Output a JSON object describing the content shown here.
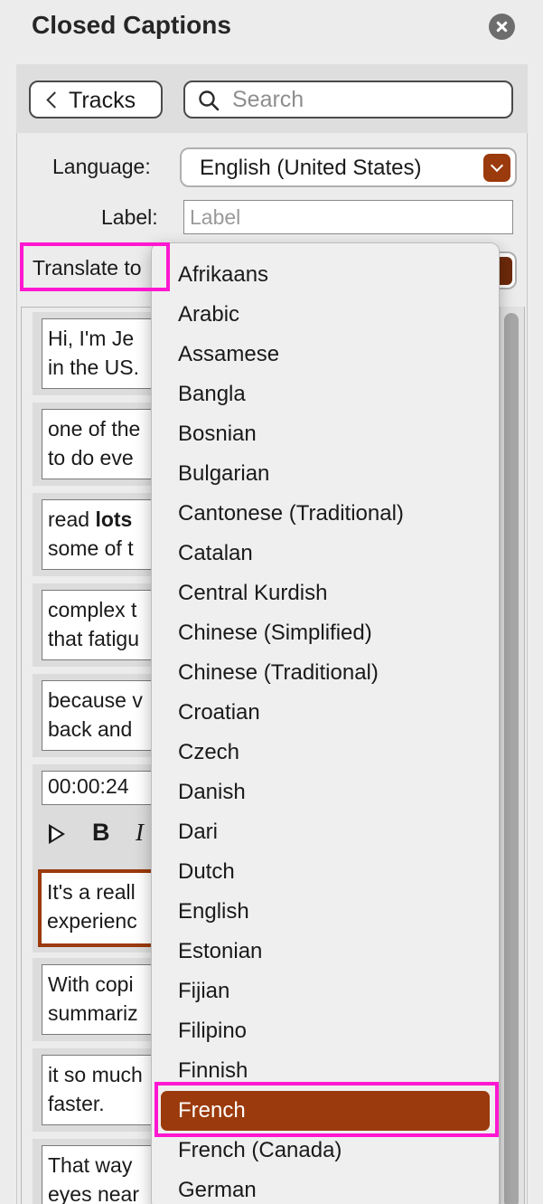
{
  "panel": {
    "title": "Closed Captions"
  },
  "toolbar": {
    "tracks_label": "Tracks",
    "search_placeholder": "Search"
  },
  "form": {
    "language_label": "Language:",
    "language_value": "English (United States)",
    "label_label": "Label:",
    "label_placeholder": "Label",
    "translate_label": "Translate to"
  },
  "captions": [
    {
      "line1": "Hi, I'm Je",
      "line2": "in the US."
    },
    {
      "line1": "one of the",
      "line2": "to do eve"
    },
    {
      "line1_plain": "read ",
      "line1_bold": "lots",
      "line2": "some of t"
    },
    {
      "line1": "complex t",
      "line2": "that fatigu"
    },
    {
      "line1": "because v",
      "line2": "back and"
    },
    {
      "time": "00:00:24"
    },
    {
      "line1": "It's a reall",
      "line2": "experienc",
      "active": true
    },
    {
      "line1": "With copi",
      "line2": "summariz"
    },
    {
      "line1": "it so much",
      "line2": "faster."
    },
    {
      "line1": "That way",
      "line2": "eyes near"
    }
  ],
  "caption_tools": {
    "play_icon": "play-icon",
    "bold": "B",
    "italic": "I"
  },
  "languages": [
    "Afrikaans",
    "Arabic",
    "Assamese",
    "Bangla",
    "Bosnian",
    "Bulgarian",
    "Cantonese (Traditional)",
    "Catalan",
    "Central Kurdish",
    "Chinese (Simplified)",
    "Chinese (Traditional)",
    "Croatian",
    "Czech",
    "Danish",
    "Dari",
    "Dutch",
    "English",
    "Estonian",
    "Fijian",
    "Filipino",
    "Finnish",
    "French",
    "French (Canada)",
    "German"
  ],
  "selected_language": "French",
  "colors": {
    "accent": "#9b3a0c",
    "highlight": "#ff17d1"
  }
}
